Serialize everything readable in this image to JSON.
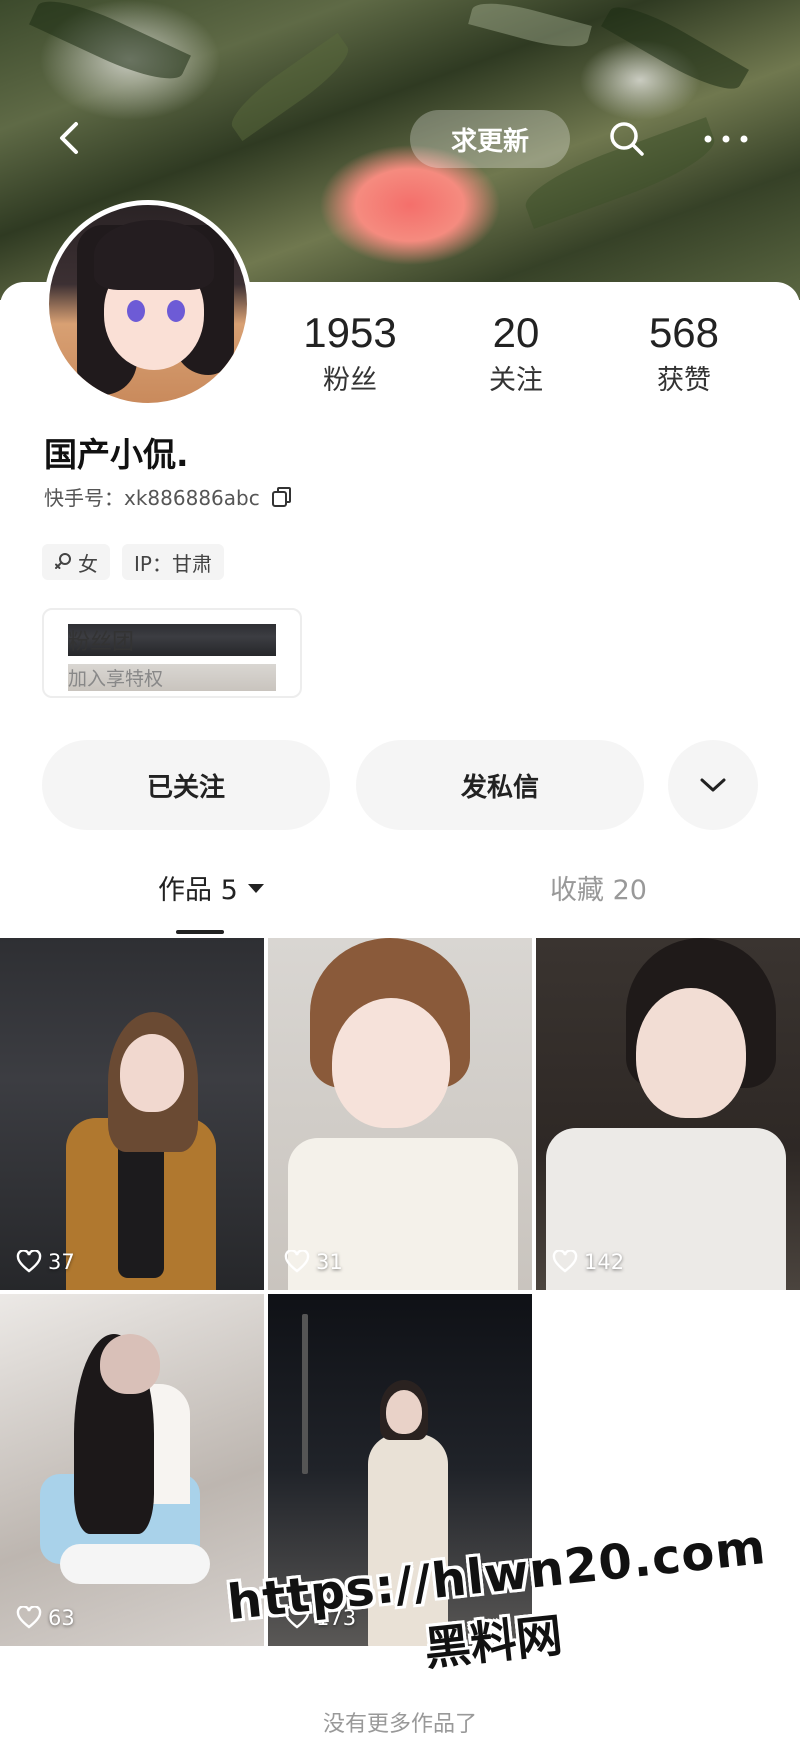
{
  "header": {
    "title": "求更新"
  },
  "profile": {
    "stats": [
      {
        "value": "1953",
        "label": "粉丝"
      },
      {
        "value": "20",
        "label": "关注"
      },
      {
        "value": "568",
        "label": "获赞"
      }
    ],
    "name": "国产小侃.",
    "kuaishou_id": "快手号：xk886886abc",
    "tags": {
      "gender": "女",
      "ip": "IP：甘肃"
    },
    "fan_club": {
      "title": "粉丝团",
      "subtitle": "加入享特权"
    }
  },
  "actions": {
    "follow": "已关注",
    "message": "发私信"
  },
  "tabs": {
    "works": "作品 5",
    "favorites": "收藏 20"
  },
  "works": [
    {
      "likes": "37"
    },
    {
      "likes": "31"
    },
    {
      "likes": "142"
    },
    {
      "likes": "63"
    },
    {
      "likes": "173"
    }
  ],
  "footer": {
    "no_more": "没有更多作品了"
  },
  "watermark": {
    "line1": "https://hlwn20.com",
    "line2": "黑料网"
  },
  "icons": {
    "back": "chevron-left-icon",
    "search": "search-icon",
    "more": "more-dots-icon",
    "copy": "copy-icon",
    "gender": "female-icon",
    "dropdown": "chevron-down-icon",
    "like": "heart-icon"
  }
}
